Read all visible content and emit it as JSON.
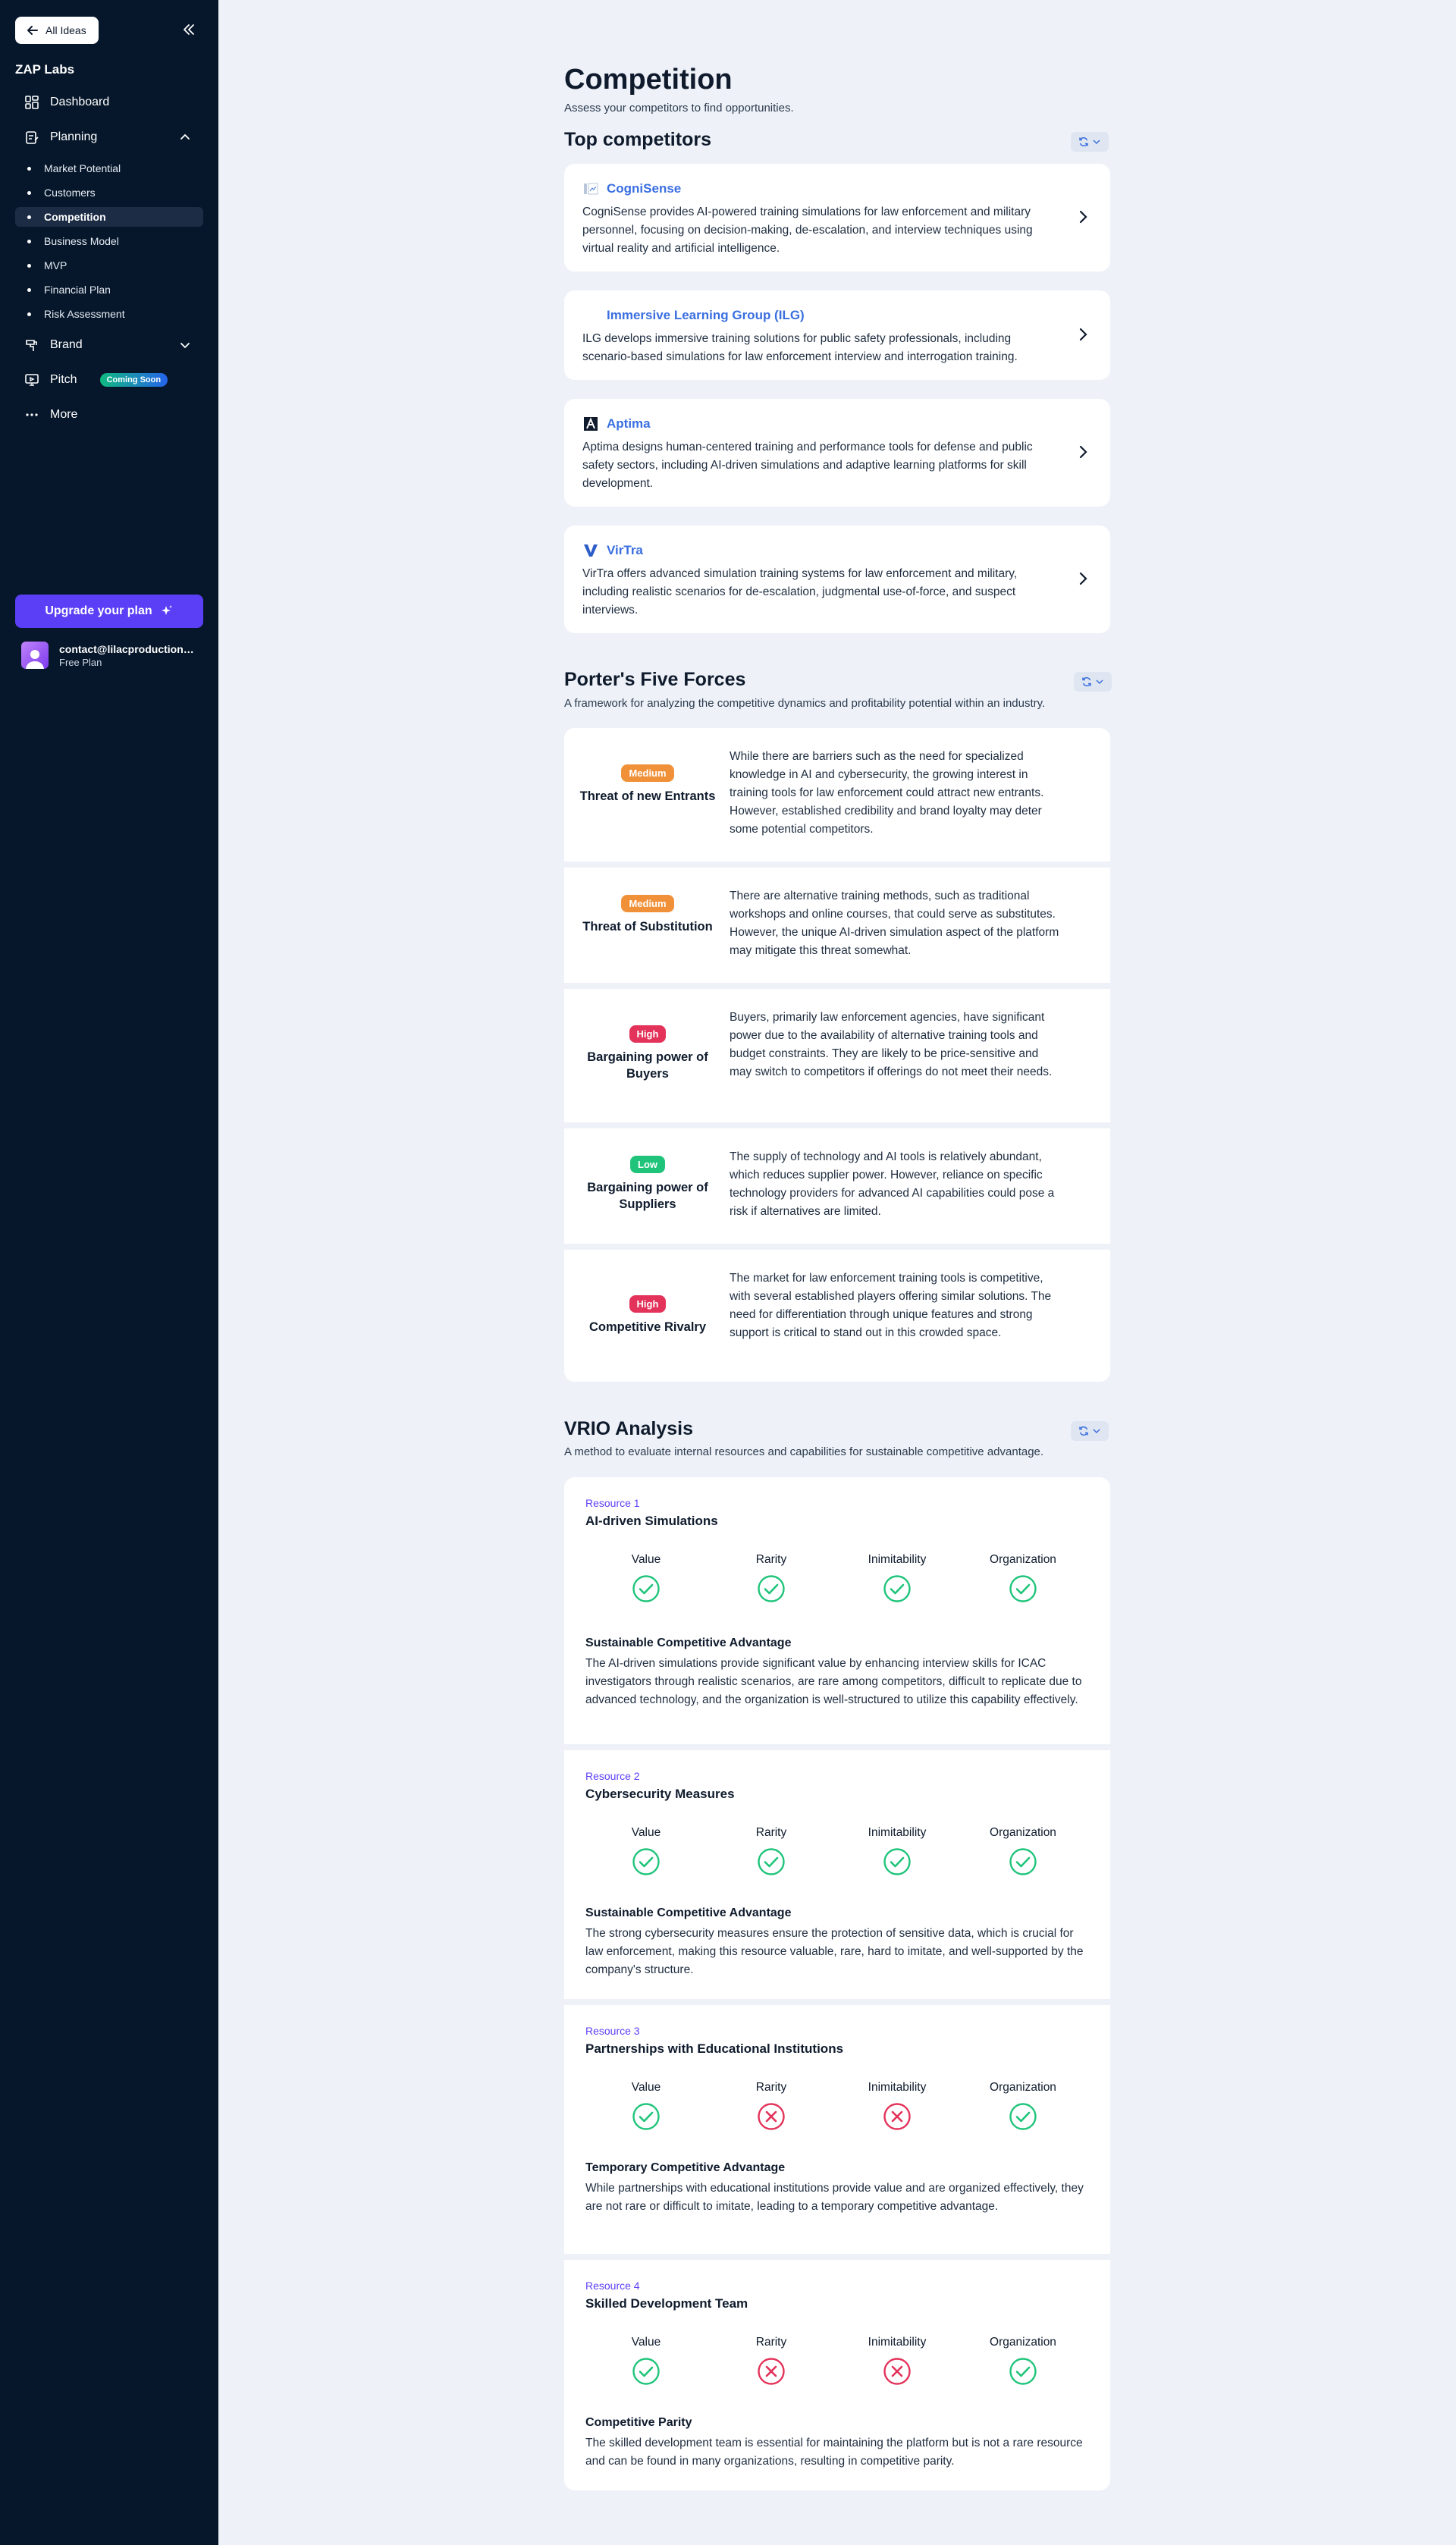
{
  "sidebar": {
    "back_label": "All Ideas",
    "org_name": "ZAP Labs",
    "dashboard": "Dashboard",
    "planning": "Planning",
    "planning_items": [
      "Market Potential",
      "Customers",
      "Competition",
      "Business Model",
      "MVP",
      "Financial Plan",
      "Risk Assessment"
    ],
    "brand": "Brand",
    "pitch": "Pitch",
    "pitch_badge": "Coming Soon",
    "more": "More",
    "upgrade": "Upgrade your plan",
    "user_email": "contact@lilacproductions.com",
    "user_plan": "Free Plan"
  },
  "page": {
    "title": "Competition",
    "subtitle": "Assess your competitors to find opportunities."
  },
  "top_competitors": {
    "title": "Top competitors",
    "items": [
      {
        "name": "CogniSense",
        "logo": "cognisense-logo",
        "desc": "CogniSense provides AI-powered training simulations for law enforcement and military personnel, focusing on decision-making, de-escalation, and interview techniques using virtual reality and artificial intelligence."
      },
      {
        "name": "Immersive Learning Group (ILG)",
        "logo": "",
        "desc": "ILG develops immersive training solutions for public safety professionals, including scenario-based simulations for law enforcement interview and interrogation training."
      },
      {
        "name": "Aptima",
        "logo": "aptima-logo",
        "desc": "Aptima designs human-centered training and performance tools for defense and public safety sectors, including AI-driven simulations and adaptive learning platforms for skill development."
      },
      {
        "name": "VirTra",
        "logo": "virtra-logo",
        "desc": "VirTra offers advanced simulation training systems for law enforcement and military, including realistic scenarios for de-escalation, judgmental use-of-force, and suspect interviews."
      }
    ]
  },
  "porter": {
    "title": "Porter's Five Forces",
    "subtitle": "A framework for analyzing the competitive dynamics and profitability potential within an industry.",
    "forces": [
      {
        "level": "Medium",
        "name": "Threat of new Entrants",
        "desc": "While there are barriers such as the need for specialized knowledge in AI and cybersecurity, the growing interest in training tools for law enforcement could attract new entrants. However, established credibility and brand loyalty may deter some potential competitors."
      },
      {
        "level": "Medium",
        "name": "Threat of Substitution",
        "desc": "There are alternative training methods, such as traditional workshops and online courses, that could serve as substitutes. However, the unique AI-driven simulation aspect of the platform may mitigate this threat somewhat."
      },
      {
        "level": "High",
        "name": "Bargaining power of Buyers",
        "desc": "Buyers, primarily law enforcement agencies, have significant power due to the availability of alternative training tools and budget constraints. They are likely to be price-sensitive and may switch to competitors if offerings do not meet their needs."
      },
      {
        "level": "Low",
        "name": "Bargaining power of Suppliers",
        "desc": "The supply of technology and AI tools is relatively abundant, which reduces supplier power. However, reliance on specific technology providers for advanced AI capabilities could pose a risk if alternatives are limited."
      },
      {
        "level": "High",
        "name": "Competitive Rivalry",
        "desc": "The market for law enforcement training tools is competitive, with several established players offering similar solutions. The need for differentiation through unique features and strong support is critical to stand out in this crowded space."
      }
    ],
    "level_colors": {
      "Medium": "#f0913a",
      "High": "#e3335a",
      "Low": "#1fc47a"
    }
  },
  "vrio": {
    "title": "VRIO Analysis",
    "subtitle": "A method to evaluate internal resources and capabilities for sustainable competitive advantage.",
    "criteria": [
      "Value",
      "Rarity",
      "Inimitability",
      "Organization"
    ],
    "resources": [
      {
        "num": "Resource 1",
        "name": "AI-driven Simulations",
        "checks": [
          true,
          true,
          true,
          true
        ],
        "adv": "Sustainable Competitive Advantage",
        "desc": "The AI-driven simulations provide significant value by enhancing interview skills for ICAC investigators through realistic scenarios, are rare among competitors, difficult to replicate due to advanced technology, and the organization is well-structured to utilize this capability effectively."
      },
      {
        "num": "Resource 2",
        "name": "Cybersecurity Measures",
        "checks": [
          true,
          true,
          true,
          true
        ],
        "adv": "Sustainable Competitive Advantage",
        "desc": "The strong cybersecurity measures ensure the protection of sensitive data, which is crucial for law enforcement, making this resource valuable, rare, hard to imitate, and well-supported by the company's structure."
      },
      {
        "num": "Resource 3",
        "name": "Partnerships with Educational Institutions",
        "checks": [
          true,
          false,
          false,
          true
        ],
        "adv": "Temporary Competitive Advantage",
        "desc": "While partnerships with educational institutions provide value and are organized effectively, they are not rare or difficult to imitate, leading to a temporary competitive advantage."
      },
      {
        "num": "Resource 4",
        "name": "Skilled Development Team",
        "checks": [
          true,
          false,
          false,
          true
        ],
        "adv": "Competitive Parity",
        "desc": "The skilled development team is essential for maintaining the platform but is not a rare resource and can be found in many organizations, resulting in competitive parity."
      }
    ]
  }
}
